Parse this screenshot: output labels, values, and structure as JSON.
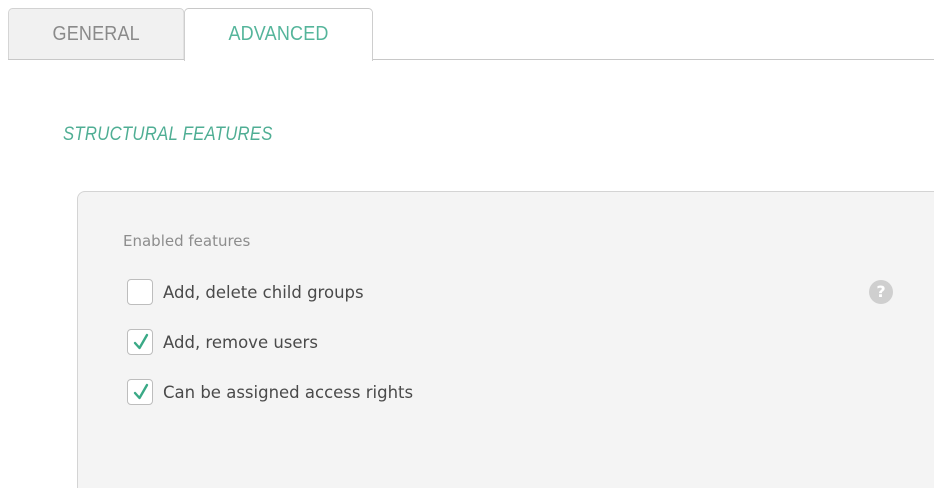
{
  "tabs": {
    "general_label": "GENERAL",
    "advanced_label": "ADVANCED",
    "active": "ADVANCED"
  },
  "section": {
    "title": "STRUCTURAL FEATURES"
  },
  "panel": {
    "label": "Enabled features",
    "help_icon": "question-mark-icon",
    "help_glyph": "?",
    "options": [
      {
        "label": "Add, delete child groups",
        "checked": false
      },
      {
        "label": "Add, remove users",
        "checked": true
      },
      {
        "label": "Can be assigned access rights",
        "checked": true
      }
    ]
  },
  "colors": {
    "accent": "#4fae94",
    "checkmark": "#3aa986",
    "panel_bg": "#f4f4f4"
  }
}
